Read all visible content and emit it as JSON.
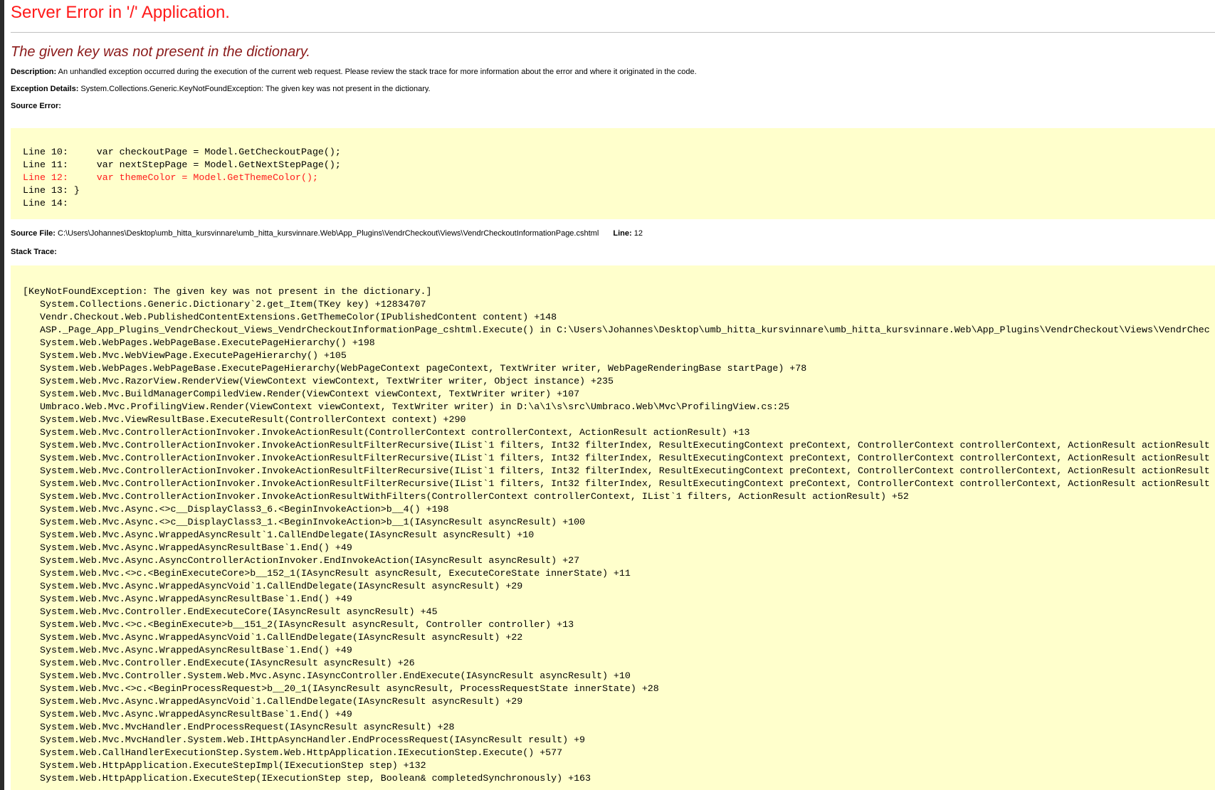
{
  "page": {
    "server_title": "Server Error in '/' Application.",
    "error_message": "The given key was not present in the dictionary."
  },
  "details": {
    "description_label": "Description:",
    "description_text": "An unhandled exception occurred during the execution of the current web request. Please review the stack trace for more information about the error and where it originated in the code.",
    "exception_label": "Exception Details:",
    "exception_text": "System.Collections.Generic.KeyNotFoundException: The given key was not present in the dictionary.",
    "source_error_label": "Source Error:",
    "source_file_label": "Source File:",
    "source_file_path": "C:\\Users\\Johannes\\Desktop\\umb_hitta_kursvinnare\\umb_hitta_kursvinnare.Web\\App_Plugins\\VendrCheckout\\Views\\VendrCheckoutInformationPage.cshtml",
    "line_label": "Line:",
    "line_number": "12",
    "stack_trace_label": "Stack Trace:"
  },
  "source_lines": [
    {
      "text": "Line 10:     var checkoutPage = Model.GetCheckoutPage();",
      "highlight": false
    },
    {
      "text": "Line 11:     var nextStepPage = Model.GetNextStepPage();",
      "highlight": false
    },
    {
      "text": "Line 12:     var themeColor = Model.GetThemeColor();",
      "highlight": true
    },
    {
      "text": "Line 13: }",
      "highlight": false
    },
    {
      "text": "Line 14:",
      "highlight": false
    }
  ],
  "stack_trace": [
    "[KeyNotFoundException: The given key was not present in the dictionary.]",
    "System.Collections.Generic.Dictionary`2.get_Item(TKey key) +12834707",
    "Vendr.Checkout.Web.PublishedContentExtensions.GetThemeColor(IPublishedContent content) +148",
    "ASP._Page_App_Plugins_VendrCheckout_Views_VendrCheckoutInformationPage_cshtml.Execute() in C:\\Users\\Johannes\\Desktop\\umb_hitta_kursvinnare\\umb_hitta_kursvinnare.Web\\App_Plugins\\VendrCheckout\\Views\\VendrChec",
    "System.Web.WebPages.WebPageBase.ExecutePageHierarchy() +198",
    "System.Web.Mvc.WebViewPage.ExecutePageHierarchy() +105",
    "System.Web.WebPages.WebPageBase.ExecutePageHierarchy(WebPageContext pageContext, TextWriter writer, WebPageRenderingBase startPage) +78",
    "System.Web.Mvc.RazorView.RenderView(ViewContext viewContext, TextWriter writer, Object instance) +235",
    "System.Web.Mvc.BuildManagerCompiledView.Render(ViewContext viewContext, TextWriter writer) +107",
    "Umbraco.Web.Mvc.ProfilingView.Render(ViewContext viewContext, TextWriter writer) in D:\\a\\1\\s\\src\\Umbraco.Web\\Mvc\\ProfilingView.cs:25",
    "System.Web.Mvc.ViewResultBase.ExecuteResult(ControllerContext context) +290",
    "System.Web.Mvc.ControllerActionInvoker.InvokeActionResult(ControllerContext controllerContext, ActionResult actionResult) +13",
    "System.Web.Mvc.ControllerActionInvoker.InvokeActionResultFilterRecursive(IList`1 filters, Int32 filterIndex, ResultExecutingContext preContext, ControllerContext controllerContext, ActionResult actionResult",
    "System.Web.Mvc.ControllerActionInvoker.InvokeActionResultFilterRecursive(IList`1 filters, Int32 filterIndex, ResultExecutingContext preContext, ControllerContext controllerContext, ActionResult actionResult",
    "System.Web.Mvc.ControllerActionInvoker.InvokeActionResultFilterRecursive(IList`1 filters, Int32 filterIndex, ResultExecutingContext preContext, ControllerContext controllerContext, ActionResult actionResult",
    "System.Web.Mvc.ControllerActionInvoker.InvokeActionResultFilterRecursive(IList`1 filters, Int32 filterIndex, ResultExecutingContext preContext, ControllerContext controllerContext, ActionResult actionResult",
    "System.Web.Mvc.ControllerActionInvoker.InvokeActionResultWithFilters(ControllerContext controllerContext, IList`1 filters, ActionResult actionResult) +52",
    "System.Web.Mvc.Async.<>c__DisplayClass3_6.<BeginInvokeAction>b__4() +198",
    "System.Web.Mvc.Async.<>c__DisplayClass3_1.<BeginInvokeAction>b__1(IAsyncResult asyncResult) +100",
    "System.Web.Mvc.Async.WrappedAsyncResult`1.CallEndDelegate(IAsyncResult asyncResult) +10",
    "System.Web.Mvc.Async.WrappedAsyncResultBase`1.End() +49",
    "System.Web.Mvc.Async.AsyncControllerActionInvoker.EndInvokeAction(IAsyncResult asyncResult) +27",
    "System.Web.Mvc.<>c.<BeginExecuteCore>b__152_1(IAsyncResult asyncResult, ExecuteCoreState innerState) +11",
    "System.Web.Mvc.Async.WrappedAsyncVoid`1.CallEndDelegate(IAsyncResult asyncResult) +29",
    "System.Web.Mvc.Async.WrappedAsyncResultBase`1.End() +49",
    "System.Web.Mvc.Controller.EndExecuteCore(IAsyncResult asyncResult) +45",
    "System.Web.Mvc.<>c.<BeginExecute>b__151_2(IAsyncResult asyncResult, Controller controller) +13",
    "System.Web.Mvc.Async.WrappedAsyncVoid`1.CallEndDelegate(IAsyncResult asyncResult) +22",
    "System.Web.Mvc.Async.WrappedAsyncResultBase`1.End() +49",
    "System.Web.Mvc.Controller.EndExecute(IAsyncResult asyncResult) +26",
    "System.Web.Mvc.Controller.System.Web.Mvc.Async.IAsyncController.EndExecute(IAsyncResult asyncResult) +10",
    "System.Web.Mvc.<>c.<BeginProcessRequest>b__20_1(IAsyncResult asyncResult, ProcessRequestState innerState) +28",
    "System.Web.Mvc.Async.WrappedAsyncVoid`1.CallEndDelegate(IAsyncResult asyncResult) +29",
    "System.Web.Mvc.Async.WrappedAsyncResultBase`1.End() +49",
    "System.Web.Mvc.MvcHandler.EndProcessRequest(IAsyncResult asyncResult) +28",
    "System.Web.Mvc.MvcHandler.System.Web.IHttpAsyncHandler.EndProcessRequest(IAsyncResult result) +9",
    "System.Web.CallHandlerExecutionStep.System.Web.HttpApplication.IExecutionStep.Execute() +577",
    "System.Web.HttpApplication.ExecuteStepImpl(IExecutionStep step) +132",
    "System.Web.HttpApplication.ExecuteStep(IExecutionStep step, Boolean& completedSynchronously) +163"
  ],
  "colors": {
    "title_red": "#ff1a1a",
    "heading_maroon": "#8b1a1a",
    "code_background": "#ffffcc"
  }
}
